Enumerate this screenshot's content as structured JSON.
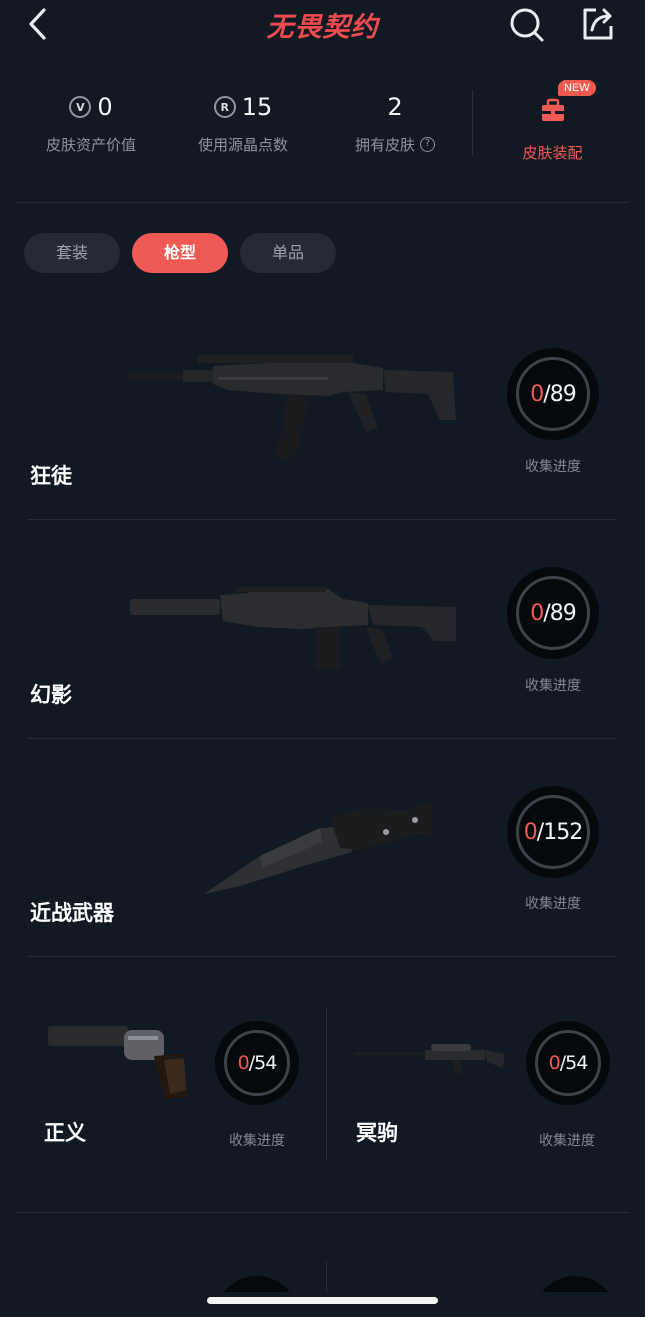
{
  "header": {
    "title": "无畏契约",
    "back_icon": "chevron-left-icon",
    "search_icon": "search-icon",
    "share_icon": "share-icon"
  },
  "stats": [
    {
      "icon": "valorant-points-icon",
      "icon_text": "V",
      "value": "0",
      "label": "皮肤资产价值"
    },
    {
      "icon": "radianite-icon",
      "icon_text": "R",
      "value": "15",
      "label": "使用源晶点数"
    },
    {
      "icon": null,
      "value": "2",
      "label": "拥有皮肤"
    }
  ],
  "equip": {
    "label": "皮肤装配",
    "badge": "NEW"
  },
  "tabs": [
    {
      "label": "套装",
      "active": false
    },
    {
      "label": "枪型",
      "active": true
    },
    {
      "label": "单品",
      "active": false
    }
  ],
  "weapons": [
    {
      "name": "狂徒",
      "collected": "0",
      "total": "/89",
      "progress_label": "收集进度"
    },
    {
      "name": "幻影",
      "collected": "0",
      "total": "/89",
      "progress_label": "收集进度"
    },
    {
      "name": "近战武器",
      "collected": "0",
      "total": "/152",
      "progress_label": "收集进度"
    },
    {
      "name": "正义",
      "collected": "0",
      "total": "/54",
      "progress_label": "收集进度"
    },
    {
      "name": "冥驹",
      "collected": "0",
      "total": "/54",
      "progress_label": "收集进度"
    }
  ],
  "colors": {
    "accent": "#ef5a55",
    "background": "#111a23",
    "ring_bg": "#06090c"
  }
}
